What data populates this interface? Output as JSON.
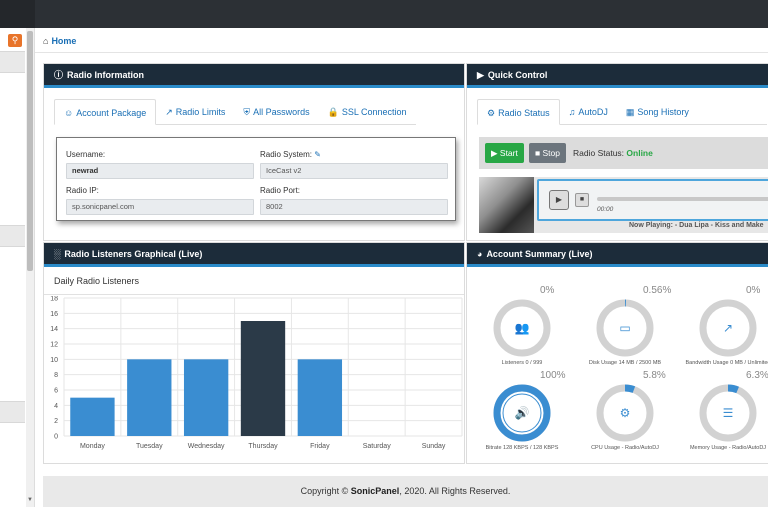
{
  "sidebar": {
    "search_icon": "search-icon",
    "accent": "#e8742a"
  },
  "breadcrumb": {
    "icon": "home-icon",
    "label": "Home"
  },
  "radio_info": {
    "title": "Radio Information",
    "icon": "info-circle-icon",
    "tabs": [
      {
        "label": "Account Package",
        "icon": "user-circle-icon"
      },
      {
        "label": "Radio Limits",
        "icon": "line-chart-icon"
      },
      {
        "label": "All Passwords",
        "icon": "shield-icon"
      },
      {
        "label": "SSL Connection",
        "icon": "lock-icon"
      }
    ],
    "fields": {
      "username_label": "Username:",
      "username": "newrad",
      "system_label": "Radio System:",
      "system": "IceCast v2",
      "ip_label": "Radio IP:",
      "ip": "sp.sonicpanel.com",
      "port_label": "Radio Port:",
      "port": "8002"
    }
  },
  "quick_control": {
    "title": "Quick Control",
    "tabs": [
      {
        "label": "Radio Status",
        "icon": "gear-icon"
      },
      {
        "label": "AutoDJ",
        "icon": "headphones-icon"
      },
      {
        "label": "Song History",
        "icon": "calendar-icon"
      }
    ],
    "start_label": "Start",
    "stop_label": "Stop",
    "status_label": "Radio Status:",
    "status_value": "Online",
    "time": "00:00",
    "now_playing": "Now Playing: - Dua Lipa - Kiss and Make"
  },
  "listeners_panel": {
    "title": "Radio Listeners Graphical (Live)",
    "subtitle": "Daily Radio Listeners"
  },
  "chart_data": {
    "type": "bar",
    "title": "Daily Radio Listeners",
    "categories": [
      "Monday",
      "Tuesday",
      "Wednesday",
      "Thursday",
      "Friday",
      "Saturday",
      "Sunday"
    ],
    "values": [
      5,
      10,
      10,
      15,
      10,
      0,
      0
    ],
    "ylim": [
      0,
      18
    ],
    "yticks": [
      0,
      2,
      4,
      6,
      8,
      10,
      12,
      14,
      16,
      18
    ],
    "bar_colors": [
      "#3a8dd1",
      "#3a8dd1",
      "#3a8dd1",
      "#2b3a48",
      "#3a8dd1",
      "#3a8dd1",
      "#3a8dd1"
    ],
    "grid": true
  },
  "account_summary": {
    "title": "Account Summary (Live)",
    "items": [
      {
        "pct": "0%",
        "value": 0,
        "label": "Listeners 0 / 999",
        "icon": "users-icon"
      },
      {
        "pct": "0.56%",
        "value": 0.56,
        "label": "Disk Usage 14 MB / 2500 MB",
        "icon": "hdd-icon"
      },
      {
        "pct": "0%",
        "value": 0,
        "label": "Bandwidth Usage 0 MB / Unlimited",
        "icon": "area-chart-icon"
      },
      {
        "pct": "100%",
        "value": 100,
        "label": "Bitrate 128 KBPS / 128 KBPS",
        "icon": "volume-icon"
      },
      {
        "pct": "5.8%",
        "value": 5.8,
        "label": "CPU Usage - Radio/AutoDJ",
        "icon": "cog-icon"
      },
      {
        "pct": "6.3%",
        "value": 6.3,
        "label": "Memory Usage - Radio/AutoDJ",
        "icon": "server-icon"
      }
    ],
    "ring_color": "#d2d2d2",
    "accent": "#3a8dd1"
  },
  "footer": {
    "prefix": "Copyright ©",
    "brand": "SonicPanel",
    "suffix": ", 2020. All Rights Reserved."
  }
}
